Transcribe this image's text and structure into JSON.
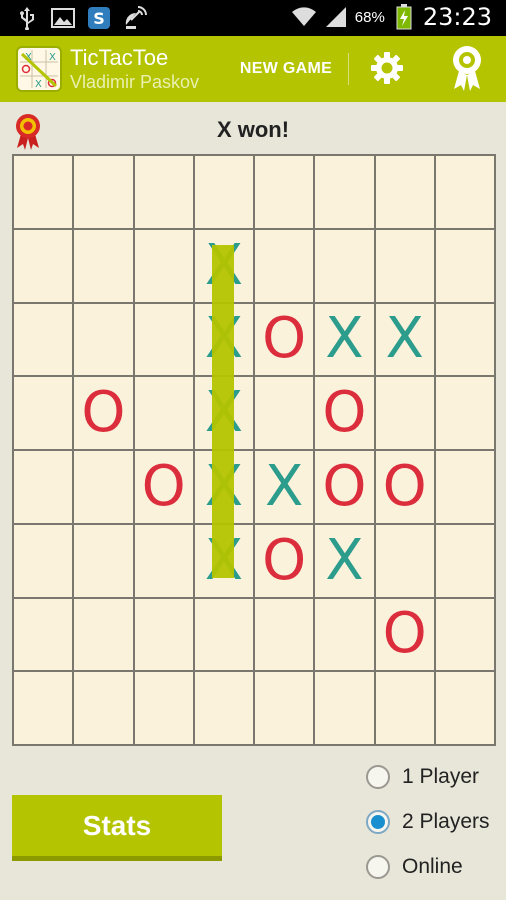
{
  "status_bar": {
    "battery_percent": "68%",
    "time": "23:23",
    "icons": [
      "usb-icon",
      "image-icon",
      "skype-icon",
      "satellite-icon",
      "wifi-icon",
      "signal-icon",
      "battery-icon"
    ]
  },
  "app_bar": {
    "title": "TicTacToe",
    "subtitle": "Vladimir Paskov",
    "new_game_label": "NEW GAME",
    "settings_icon": "gear-icon",
    "award_icon": "award-ribbon-icon"
  },
  "game": {
    "status": "X won!",
    "status_icon": "rosette-icon",
    "board_size": 8,
    "win_line": {
      "orientation": "vertical",
      "column": 4,
      "from_row": 2,
      "to_row": 6
    },
    "cells": [
      [
        "",
        "",
        "",
        "",
        "",
        "",
        "",
        ""
      ],
      [
        "",
        "",
        "",
        "X",
        "",
        "",
        "",
        ""
      ],
      [
        "",
        "",
        "",
        "X",
        "O",
        "X",
        "X",
        ""
      ],
      [
        "",
        "O",
        "",
        "X",
        "",
        "O",
        "",
        ""
      ],
      [
        "",
        "",
        "O",
        "X",
        "X",
        "O",
        "O",
        ""
      ],
      [
        "",
        "",
        "",
        "X",
        "O",
        "X",
        "",
        ""
      ],
      [
        "",
        "",
        "",
        "",
        "",
        "",
        "O",
        ""
      ],
      [
        "",
        "",
        "",
        "",
        "",
        "",
        "",
        ""
      ]
    ]
  },
  "stats_button": {
    "label": "Stats"
  },
  "player_mode": {
    "selected": "2 Players",
    "options": [
      {
        "label": "1 Player",
        "checked": false
      },
      {
        "label": "2 Players",
        "checked": true
      },
      {
        "label": "Online",
        "checked": false
      }
    ]
  },
  "colors": {
    "accent": "#b4c400",
    "x_color": "#2c9c8c",
    "o_color": "#dc2d3c",
    "cell_bg": "#fbf2dc",
    "page_bg": "#e8e6d9"
  }
}
